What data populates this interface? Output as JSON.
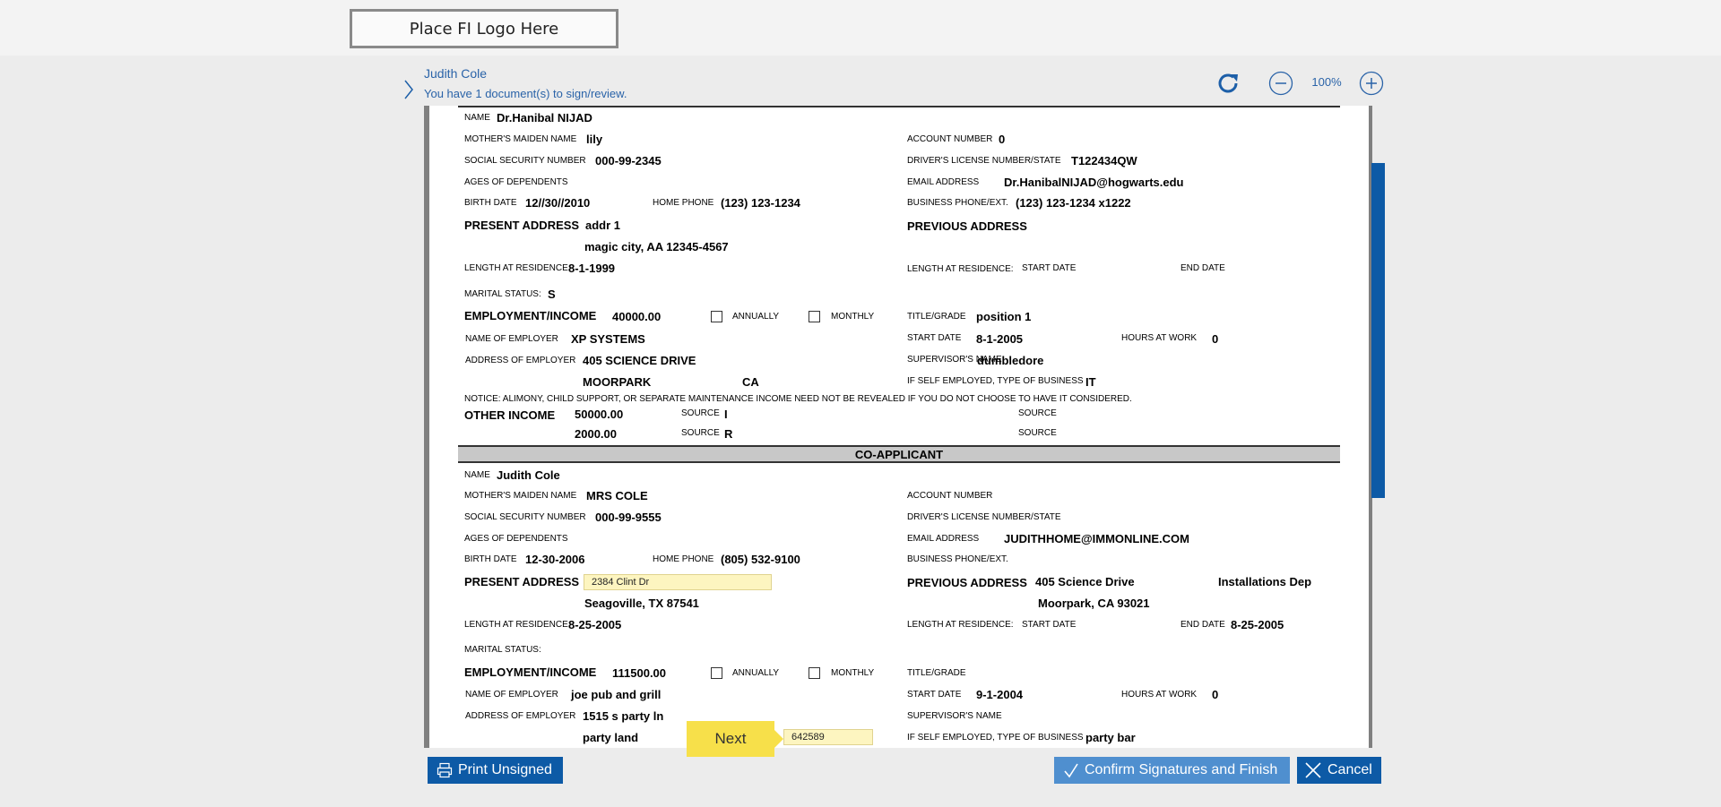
{
  "logo_placeholder": "Place FI Logo Here",
  "header": {
    "user_name": "Judith Cole",
    "doc_status": "You have 1 document(s) to sign/review.",
    "zoom": "100%"
  },
  "applicant": {
    "name_label": "NAME",
    "name": "Dr.Hanibal NIJAD",
    "mmn_label": "MOTHER'S MAIDEN NAME",
    "mmn": "lily",
    "acct_label": "ACCOUNT NUMBER",
    "acct": "0",
    "ssn_label": "SOCIAL SECURITY NUMBER",
    "ssn": "000-99-2345",
    "dl_label": "DRIVER'S LICENSE NUMBER/STATE",
    "dl": "T122434QW",
    "ages_label": "AGES OF DEPENDENTS",
    "email_label": "EMAIL ADDRESS",
    "email": "Dr.HanibalNIJAD@hogwarts.edu",
    "birth_label": "BIRTH DATE",
    "birth": "12//30//2010",
    "home_phone_label": "HOME PHONE",
    "home_phone": "(123) 123-1234",
    "biz_phone_label": "BUSINESS PHONE/EXT.",
    "biz_phone": "(123) 123-1234 x1222",
    "present_label": "PRESENT ADDRESS",
    "present_line1": "addr 1",
    "present_line2": "magic city, AA 12345-4567",
    "previous_label": "PREVIOUS ADDRESS",
    "length_label": "LENGTH AT RESIDENCE",
    "length": "8-1-1999",
    "length2_label": "LENGTH AT RESIDENCE:",
    "start_date_label": "START DATE",
    "end_date_label": "END DATE",
    "marital_label": "MARITAL STATUS:",
    "marital": "S",
    "emp_label": "EMPLOYMENT/INCOME",
    "emp_income": "40000.00",
    "annually_label": "ANNUALLY",
    "monthly_label": "MONTHLY",
    "title_label": "TITLE/GRADE",
    "title": "position 1",
    "employer_label": "NAME OF EMPLOYER",
    "employer": "XP SYSTEMS",
    "emp_start_label": "START DATE",
    "emp_start": "8-1-2005",
    "hours_label": "HOURS AT WORK",
    "hours": "0",
    "emp_addr_label": "ADDRESS OF EMPLOYER",
    "emp_addr": "405 SCIENCE DRIVE",
    "supervisor_label": "SUPERVISOR'S NAME",
    "supervisor": "dumbledore",
    "emp_city": "MOORPARK",
    "emp_state": "CA",
    "self_emp_label": "IF SELF EMPLOYED, TYPE OF BUSINESS",
    "self_emp": "IT",
    "notice": "NOTICE: ALIMONY, CHILD SUPPORT, OR SEPARATE MAINTENANCE INCOME NEED NOT BE REVEALED IF YOU DO NOT CHOOSE TO HAVE IT CONSIDERED.",
    "other_income_label": "OTHER INCOME",
    "other_income_1": "50000.00",
    "source_label": "SOURCE",
    "source_1": "I",
    "other_income_2": "2000.00",
    "source_2": "R"
  },
  "coapplicant": {
    "section_title": "CO-APPLICANT",
    "name_label": "NAME",
    "name": "Judith Cole",
    "mmn_label": "MOTHER'S MAIDEN NAME",
    "mmn": "MRS COLE",
    "acct_label": "ACCOUNT NUMBER",
    "ssn_label": "SOCIAL SECURITY NUMBER",
    "ssn": "000-99-9555",
    "dl_label": "DRIVER'S LICENSE NUMBER/STATE",
    "ages_label": "AGES OF DEPENDENTS",
    "email_label": "EMAIL ADDRESS",
    "email": "JUDITHHOME@IMMONLINE.COM",
    "birth_label": "BIRTH DATE",
    "birth": "12-30-2006",
    "home_phone_label": "HOME PHONE",
    "home_phone": "(805) 532-9100",
    "biz_phone_label": "BUSINESS PHONE/EXT.",
    "present_label": "PRESENT ADDRESS",
    "present_field": "2384 Clint Dr",
    "present_line2": "Seagoville, TX 87541",
    "previous_label": "PREVIOUS ADDRESS",
    "previous_line1": "405 Science Drive",
    "previous_extra": "Installations Dep",
    "previous_line2": "Moorpark, CA 93021",
    "length_label": "LENGTH AT RESIDENCE",
    "length": "8-25-2005",
    "length2_label": "LENGTH AT RESIDENCE:",
    "start_date_label": "START DATE",
    "end_date_label": "END DATE",
    "end_date": "8-25-2005",
    "marital_label": "MARITAL STATUS:",
    "emp_label": "EMPLOYMENT/INCOME",
    "emp_income": "111500.00",
    "annually_label": "ANNUALLY",
    "monthly_label": "MONTHLY",
    "title_label": "TITLE/GRADE",
    "employer_label": "NAME OF EMPLOYER",
    "employer": "joe pub and grill",
    "emp_start_label": "START DATE",
    "emp_start": "9-1-2004",
    "hours_label": "HOURS AT WORK",
    "hours": "0",
    "emp_addr_label": "ADDRESS OF EMPLOYER",
    "emp_addr": "1515 s party ln",
    "supervisor_label": "SUPERVISOR'S NAME",
    "emp_city": "party land",
    "zip_field": "642589",
    "self_emp_label": "IF SELF EMPLOYED, TYPE OF BUSINESS",
    "self_emp": "party bar"
  },
  "buttons": {
    "next": "Next",
    "print": "Print Unsigned",
    "confirm": "Confirm Signatures and Finish",
    "cancel": "Cancel"
  },
  "colors": {
    "primary": "#0d5aa6",
    "confirm": "#4f8fcf",
    "next": "#f7e04a",
    "field_highlight": "#fdf5c0"
  },
  "icons": [
    "chevron-right-icon",
    "refresh-icon",
    "zoom-out-icon",
    "zoom-in-icon",
    "printer-icon",
    "checkmark-icon",
    "close-icon"
  ]
}
